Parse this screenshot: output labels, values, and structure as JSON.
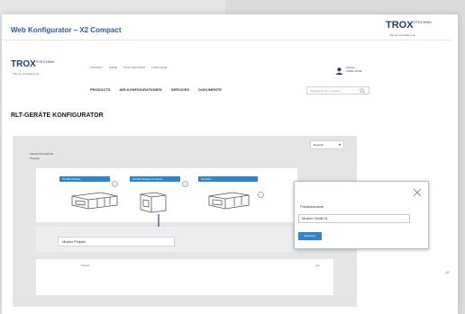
{
  "slide": {
    "title": "Web Konfigurator – X2 Compact",
    "logo_main": "TROX",
    "logo_suffix": "®TECHNIK",
    "logo_tagline": "The art of handling air",
    "page_number": "10"
  },
  "site": {
    "logo_main": "TROX",
    "logo_suffix": "®TECHNIK",
    "logo_tagline": "The art of handling air",
    "top_nav": [
      "KONTAKT",
      "HOME",
      "TROX WELTWEIT",
      "LANGUAGE"
    ],
    "main_nav": [
      "PRODUCTS",
      "AIR-KONFIGURATIONEN",
      "SERVICES",
      "DOKUMENTE"
    ],
    "user": {
      "line1": "sample",
      "line2": "USER ZONE"
    },
    "search_placeholder": "Suchbegriff hier eingeben",
    "page_heading": "RLT-GERÄTE KONFIGURATOR"
  },
  "configurator": {
    "language": "Deutsch",
    "breadcrumb_line1": "MEINE PROJEKTE",
    "breadcrumb_line2": "Projekte",
    "units": [
      {
        "label": "X2-ZENTRALE"
      },
      {
        "label": "X2-ZENTRALE Compact"
      },
      {
        "label": "X2-DUO"
      }
    ],
    "project_name": "Muster Projekt",
    "table_col_a": "Projekt",
    "table_col_b": "Akt."
  },
  "dialog": {
    "label": "Positionsname",
    "input_value": "Muster Gerät 01",
    "save_label": "Speichern"
  },
  "colors": {
    "accent_blue": "#2d86c9",
    "brand_navy": "#1d3f6e",
    "title_blue": "#2a5d9a"
  }
}
